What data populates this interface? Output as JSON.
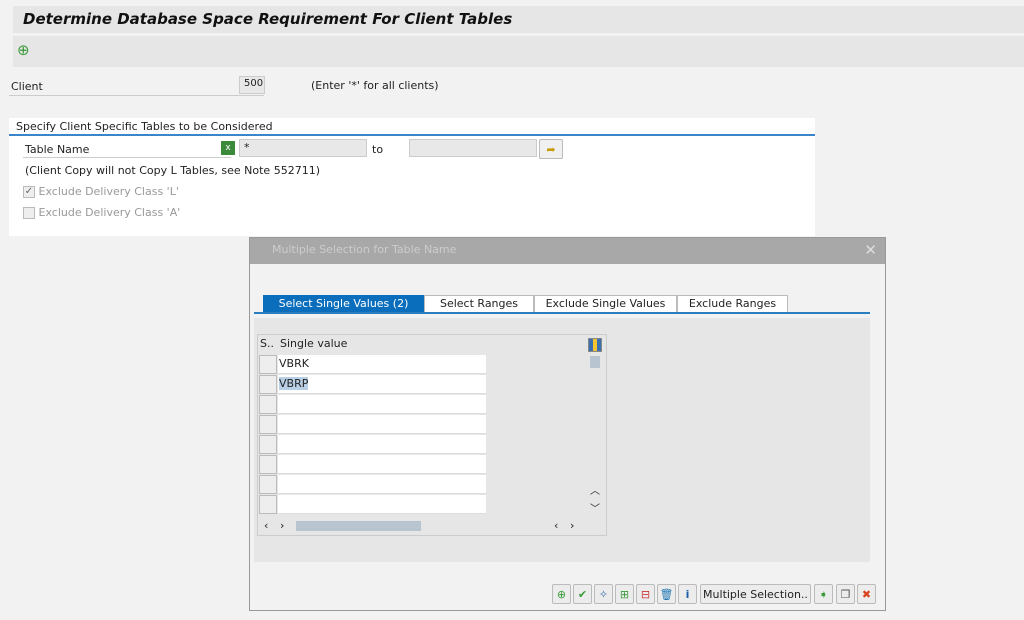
{
  "header": {
    "title": "Determine Database Space Requirement For Client Tables"
  },
  "toolbar": {
    "execute_icon": "execute-icon"
  },
  "client": {
    "label": "Client",
    "value": "500",
    "hint": "(Enter '*' for all clients)"
  },
  "group": {
    "title": "Specify Client Specific Tables to be Considered",
    "table_name_label": "Table Name",
    "from_value": "*",
    "to_label": "to",
    "to_value": "",
    "note": "(Client Copy will not Copy L Tables, see Note 552711)",
    "exclude_l": {
      "label": "Exclude Delivery Class 'L'",
      "checked": true
    },
    "exclude_a": {
      "label": "Exclude Delivery Class 'A'",
      "checked": false
    }
  },
  "dialog": {
    "title": "Multiple Selection for Table Name",
    "tabs": [
      {
        "label": "Select Single Values (2)"
      },
      {
        "label": "Select Ranges"
      },
      {
        "label": "Exclude Single Values"
      },
      {
        "label": "Exclude Ranges"
      }
    ],
    "table": {
      "col_sel": "S..",
      "col_value": "Single value",
      "rows": [
        "VBRK",
        "VBRP",
        "",
        "",
        "",
        "",
        "",
        ""
      ]
    },
    "buttons": {
      "multiple_selection": "Multiple Selection.."
    }
  }
}
